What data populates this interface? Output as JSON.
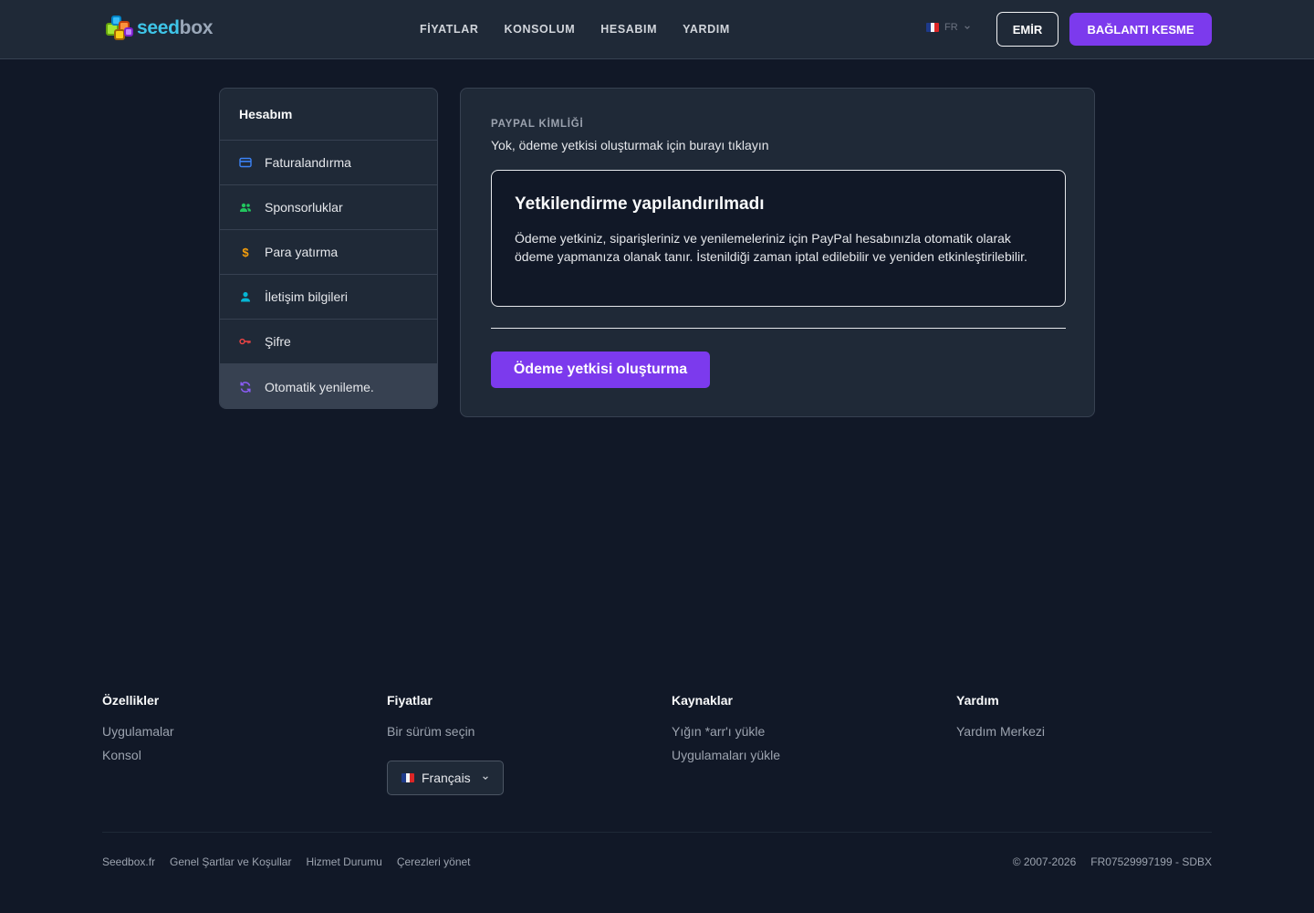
{
  "brand": {
    "logo_seed": "seed",
    "logo_box": "box"
  },
  "nav": {
    "items": [
      "FİYATLAR",
      "KONSOLUM",
      "HESABIM",
      "YARDIM"
    ],
    "lang_code": "FR",
    "user_button": "EMİR",
    "logout_button": "BAĞLANTI KESME"
  },
  "sidebar": {
    "title": "Hesabım",
    "items": [
      {
        "label": "Faturalandırma",
        "icon": "credit-card-icon",
        "color": "#3b82f6"
      },
      {
        "label": "Sponsorluklar",
        "icon": "users-icon",
        "color": "#22c55e"
      },
      {
        "label": "Para yatırma",
        "icon": "dollar-icon",
        "color": "#f59e0b"
      },
      {
        "label": "İletişim bilgileri",
        "icon": "user-icon",
        "color": "#06b6d4"
      },
      {
        "label": "Şifre",
        "icon": "key-icon",
        "color": "#ef4444"
      },
      {
        "label": "Otomatik yenileme.",
        "icon": "refresh-icon",
        "color": "#8b5cf6",
        "active": true
      }
    ]
  },
  "main": {
    "paypal_label": "PAYPAL KİMLİĞİ",
    "paypal_value": "Yok, ödeme yetkisi oluşturmak için burayı tıklayın",
    "notice_title": "Yetkilendirme yapılandırılmadı",
    "notice_text": "Ödeme yetkiniz, siparişleriniz ve yenilemeleriniz için PayPal hesabınızla otomatik olarak ödeme yapmanıza olanak tanır. İstenildiği zaman iptal edilebilir ve yeniden etkinleştirilebilir.",
    "authorize_button": "Ödeme yetkisi oluşturma"
  },
  "footer": {
    "columns": [
      {
        "title": "Özellikler",
        "links": [
          "Uygulamalar",
          "Konsol"
        ]
      },
      {
        "title": "Fiyatlar",
        "links": [
          "Bir sürüm seçin"
        ]
      },
      {
        "title": "Kaynaklar",
        "links": [
          "Yığın *arr'ı yükle",
          "Uygulamaları yükle"
        ]
      },
      {
        "title": "Yardım",
        "links": [
          "Yardım Merkezi"
        ]
      }
    ],
    "language_select": "Français",
    "bottom_links": [
      "Seedbox.fr",
      "Genel Şartlar ve Koşullar",
      "Hizmet Durumu",
      "Çerezleri yönet"
    ],
    "copyright": "© 2007-2026",
    "company_id": "FR07529997199 - SDBX"
  },
  "colors": {
    "accent": "#7c3aed",
    "background": "#111827",
    "surface": "#1f2937"
  }
}
